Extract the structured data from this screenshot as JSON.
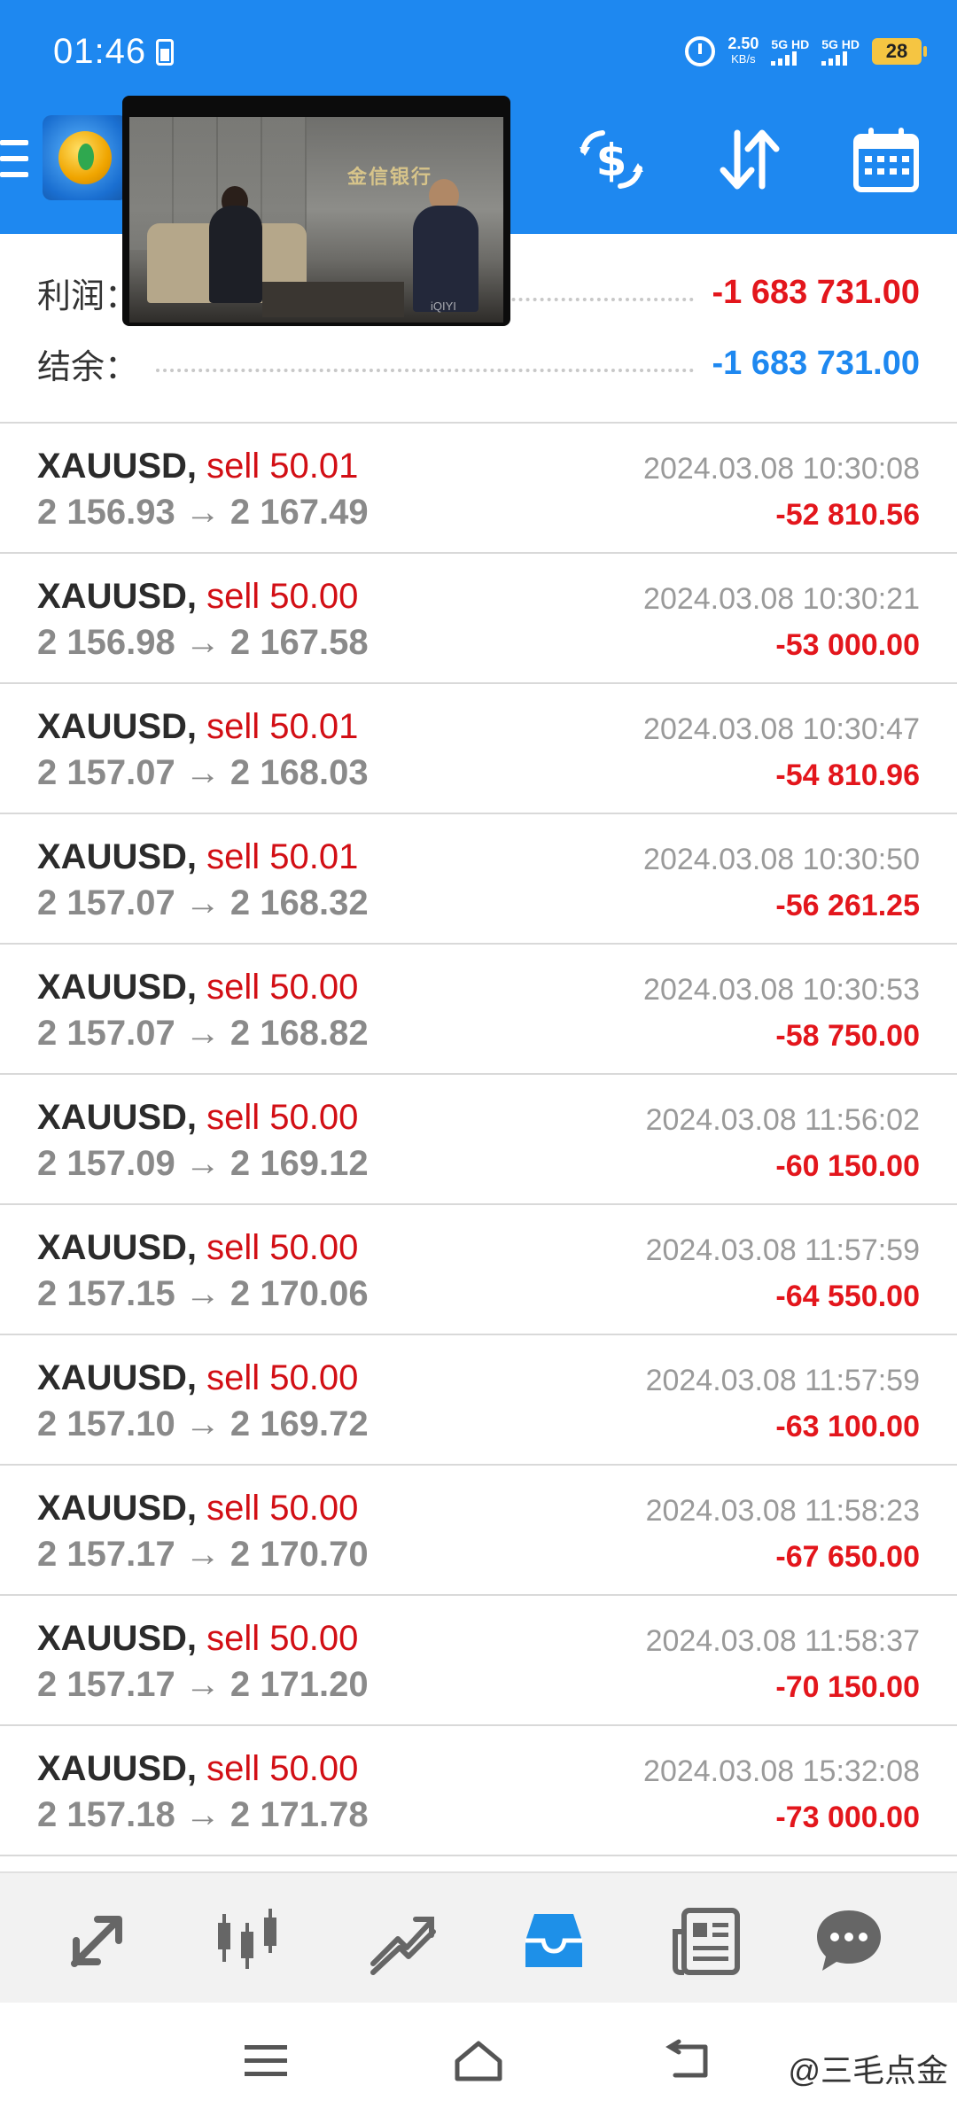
{
  "status_bar": {
    "time": "01:46",
    "speed_value": "2.50",
    "speed_unit": "KB/s",
    "sim1_label": "5G HD",
    "sim2_label": "5G HD",
    "battery": "28"
  },
  "toolbar": {
    "menu_icon": "hamburger-icon",
    "app_icon": "metatrader-logo",
    "icons": [
      "currency-exchange-icon",
      "sort-icon",
      "calendar-icon"
    ]
  },
  "video_overlay": {
    "sign_text": "金信银行",
    "watermark": "iQIYI"
  },
  "summary": {
    "profit_label": "利润：",
    "profit_value": "-1 683 731.00",
    "balance_label": "结余：",
    "balance_value": "-1 683 731.00"
  },
  "trades": [
    {
      "symbol": "XAUUSD,",
      "side": "sell 50.01",
      "prices": "2 156.93 → 2 167.49",
      "time": "2024.03.08 10:30:08",
      "pl": "-52 810.56"
    },
    {
      "symbol": "XAUUSD,",
      "side": "sell 50.00",
      "prices": "2 156.98 → 2 167.58",
      "time": "2024.03.08 10:30:21",
      "pl": "-53 000.00"
    },
    {
      "symbol": "XAUUSD,",
      "side": "sell 50.01",
      "prices": "2 157.07 → 2 168.03",
      "time": "2024.03.08 10:30:47",
      "pl": "-54 810.96"
    },
    {
      "symbol": "XAUUSD,",
      "side": "sell 50.01",
      "prices": "2 157.07 → 2 168.32",
      "time": "2024.03.08 10:30:50",
      "pl": "-56 261.25"
    },
    {
      "symbol": "XAUUSD,",
      "side": "sell 50.00",
      "prices": "2 157.07 → 2 168.82",
      "time": "2024.03.08 10:30:53",
      "pl": "-58 750.00"
    },
    {
      "symbol": "XAUUSD,",
      "side": "sell 50.00",
      "prices": "2 157.09 → 2 169.12",
      "time": "2024.03.08 11:56:02",
      "pl": "-60 150.00"
    },
    {
      "symbol": "XAUUSD,",
      "side": "sell 50.00",
      "prices": "2 157.15 → 2 170.06",
      "time": "2024.03.08 11:57:59",
      "pl": "-64 550.00"
    },
    {
      "symbol": "XAUUSD,",
      "side": "sell 50.00",
      "prices": "2 157.10 → 2 169.72",
      "time": "2024.03.08 11:57:59",
      "pl": "-63 100.00"
    },
    {
      "symbol": "XAUUSD,",
      "side": "sell 50.00",
      "prices": "2 157.17 → 2 170.70",
      "time": "2024.03.08 11:58:23",
      "pl": "-67 650.00"
    },
    {
      "symbol": "XAUUSD,",
      "side": "sell 50.00",
      "prices": "2 157.17 → 2 171.20",
      "time": "2024.03.08 11:58:37",
      "pl": "-70 150.00"
    },
    {
      "symbol": "XAUUSD,",
      "side": "sell 50.00",
      "prices": "2 157.18 → 2 171.78",
      "time": "2024.03.08 15:32:08",
      "pl": "-73 000.00"
    }
  ],
  "bottom_nav": [
    "quotes-icon",
    "chart-icon",
    "trade-icon",
    "history-icon",
    "news-icon",
    "chat-icon"
  ],
  "bottom_nav_active": "history-icon",
  "system_nav": [
    "menu-icon",
    "home-icon",
    "back-icon"
  ],
  "watermark": "@三毛点金",
  "colors": {
    "header_blue": "#1e88f0",
    "loss_red": "#e3161c",
    "sell_red": "#d20f15",
    "active_nav": "#1e90e8"
  }
}
